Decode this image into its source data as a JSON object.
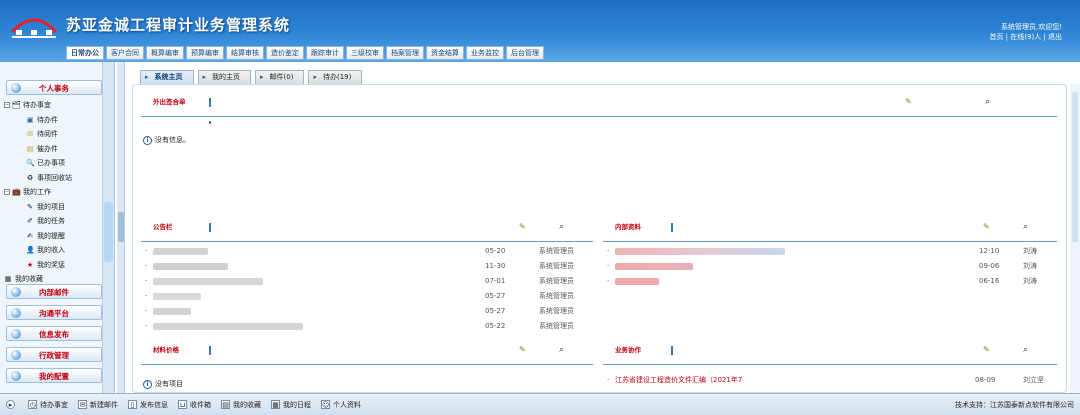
{
  "header": {
    "title": "苏亚金诚工程审计业务管理系统",
    "greeting": "系统管理员,欢迎您!",
    "links": [
      "首页",
      "在线(9)人",
      "退出"
    ]
  },
  "nav": [
    "日常办公",
    "客户合同",
    "概算编审",
    "预算编审",
    "结算审核",
    "造价鉴定",
    "跟踪审计",
    "三级校审",
    "档案管理",
    "资金结算",
    "业务监控",
    "后台管理"
  ],
  "sidebar": {
    "personal": "个人事务",
    "tree": {
      "todo_group": "待办事宜",
      "todo": [
        "待办件",
        "待阅件",
        "催办件",
        "已办事项",
        "事项回收站"
      ],
      "work_group": "我的工作",
      "work": [
        "我的项目",
        "我的任务",
        "我的提醒",
        "我的收入",
        "我的奖惩"
      ],
      "favorites": "我的收藏"
    },
    "sections": [
      "内部邮件",
      "沟通平台",
      "信息发布",
      "行政管理",
      "我的配置"
    ]
  },
  "tabs": [
    {
      "label": "系统主页"
    },
    {
      "label": "我的主页"
    },
    {
      "label": "邮件(0)"
    },
    {
      "label": "待办(19)"
    }
  ],
  "panels": {
    "outsourced": {
      "title": "外出签合单",
      "empty": "没有信息。"
    },
    "notices": {
      "title": "公告栏",
      "rows": [
        {
          "date": "05-20",
          "author": "系统管理员"
        },
        {
          "date": "11-30",
          "author": "系统管理员"
        },
        {
          "date": "07-01",
          "author": "系统管理员"
        },
        {
          "date": "05-27",
          "author": "系统管理员"
        },
        {
          "date": "05-27",
          "author": "系统管理员"
        },
        {
          "date": "05-22",
          "author": "系统管理员"
        }
      ]
    },
    "internal": {
      "title": "内部资料",
      "rows": [
        {
          "date": "12-10",
          "author": "刘涛"
        },
        {
          "date": "09-06",
          "author": "刘涛"
        },
        {
          "date": "06-16",
          "author": "刘涛"
        }
      ]
    },
    "materials": {
      "title": "材料价格",
      "empty": "没有项目"
    },
    "business": {
      "title": "业务协作",
      "rows": [
        {
          "text": "江苏省建设工程造价文件汇编（2021年7",
          "date": "08-09",
          "author": "刘立坚"
        }
      ]
    }
  },
  "footer": {
    "items": [
      "待办事宜",
      "新建邮件",
      "发布信息",
      "收件箱",
      "我的收藏",
      "我的日程",
      "个人资料"
    ],
    "support": "技术支持：江苏国泰新点软件有限公司"
  },
  "colors": {
    "header_top": "#1f6fc4",
    "accent_red": "#c5000f",
    "panel_line": "#5fa0c4"
  }
}
